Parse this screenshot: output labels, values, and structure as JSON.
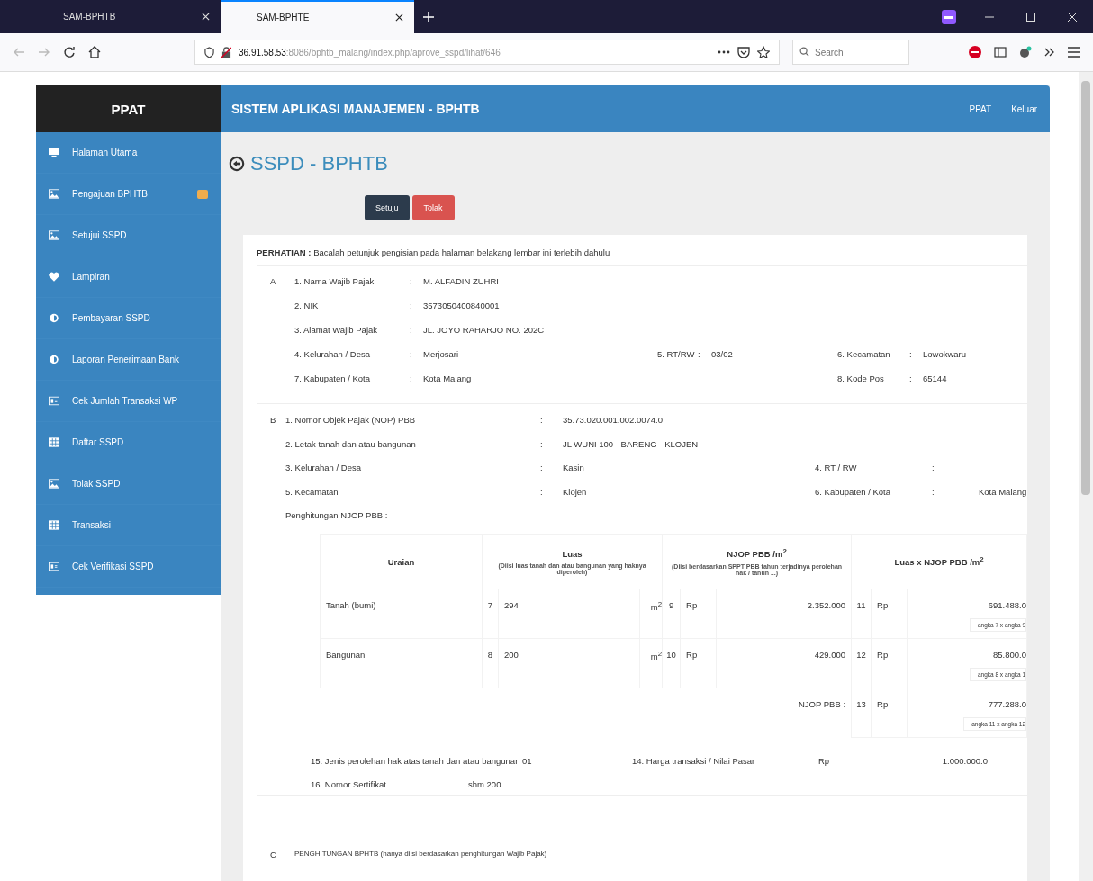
{
  "browser": {
    "tabs": [
      {
        "title": "SAM-BPHTB",
        "selected": false
      },
      {
        "title": "SAM-BPHTE",
        "selected": true
      }
    ],
    "url": {
      "host": "36.91.58.53",
      "path": ":8086/bphtb_malang/index.php/aprove_sspd/lihat/646"
    },
    "search": {
      "placeholder": "Search"
    }
  },
  "sidebar": {
    "title": "PPAT",
    "items": [
      {
        "label": "Halaman Utama",
        "badge": false
      },
      {
        "label": "Pengajuan BPHTB",
        "badge": true
      },
      {
        "label": "Setujui SSPD",
        "badge": false
      },
      {
        "label": "Lampiran",
        "badge": false
      },
      {
        "label": "Pembayaran SSPD",
        "badge": false
      },
      {
        "label": "Laporan Penerimaan Bank",
        "badge": false
      },
      {
        "label": "Cek Jumlah Transaksi WP",
        "badge": false
      },
      {
        "label": "Daftar SSPD",
        "badge": false
      },
      {
        "label": "Tolak SSPD",
        "badge": false
      },
      {
        "label": "Transaksi",
        "badge": false
      },
      {
        "label": "Cek Verifikasi SSPD",
        "badge": false
      }
    ]
  },
  "header": {
    "title": "SISTEM APLIKASI MANAJEMEN - BPHTB",
    "links": [
      "PPAT",
      "Keluar"
    ]
  },
  "page_title": "SSPD - BPHTB",
  "actions": [
    {
      "label": "Setuju",
      "kind": "approve"
    },
    {
      "label": "Tolak",
      "kind": "reject"
    }
  ],
  "notice": "**PERHATIAN :** Bacalah petunjuk pengisian pada halaman belakang lembar ini terlebih dahulu",
  "section_a": {
    "letter": "A",
    "separator": ":",
    "rows": [
      {
        "label": "1. Nama Wajib Pajak",
        "value": "M. ALFADIN ZUHRI"
      },
      {
        "label": "2. NIK",
        "value": "3573050400840001"
      },
      {
        "label": "3. Alamat Wajib Pajak",
        "value": "JL. JOYO RAHARJO NO. 202C"
      },
      {
        "label": "4. Kelurahan / Desa",
        "value": "Merjosari",
        "middle": {
          "label": "5. RT/RW",
          "value": "03/02"
        },
        "right": {
          "label": "6. Kecamatan",
          "value": "Lowokwaru"
        }
      },
      {
        "label": "7. Kabupaten / Kota",
        "value": "Kota Malang",
        "right": {
          "label": "8. Kode Pos",
          "value": "65144"
        }
      }
    ]
  },
  "section_b": {
    "letter": "B",
    "separator": ":",
    "rows": [
      {
        "label": "1. Nomor Objek Pajak (NOP) PBB",
        "value": "35.73.020.001.002.0074.0"
      },
      {
        "label": "2. Letak tanah dan atau bangunan",
        "value": "JL WUNI 100 - BARENG - KLOJEN"
      },
      {
        "label": "3. Kelurahan / Desa",
        "value": "Kasin",
        "right": {
          "label": "4. RT / RW"
        }
      },
      {
        "label": "5. Kecamatan",
        "value": "Klojen",
        "right": {
          "label": "6. Kabupaten / Kota",
          "value": "Kota Malang"
        }
      }
    ],
    "calc_label": "Penghitungan NJOP PBB :",
    "table": {
      "columns": [
        {
          "title": "Uraian"
        },
        {
          "title": "Luas",
          "note": "(Diisi luas tanah dan atau bangunan yang haknya diperoleh)"
        },
        {
          "title": "NJOP PBB /m$^{2}$",
          "note": "(Diisi berdasarkan SPPT PBB tahun terjadinya perolehan hak / tahun ...)"
        },
        {
          "title": "Luas x NJOP PBB /m$^{2}$"
        }
      ],
      "rows": [
        {
          "item": "Tanah (bumi)",
          "area_no": "7",
          "area": "294",
          "unit": "m$^{2}$",
          "njop_no": "9",
          "njop_currency": "Rp",
          "njop": "2.352.000",
          "total_no": "11",
          "total_currency": "Rp",
          "total": "691.488.0",
          "formula": "angka 7 x angka 9"
        },
        {
          "item": "Bangunan",
          "area_no": "8",
          "area": "200",
          "unit": "m$^{2}$",
          "njop_no": "10",
          "njop_currency": "Rp",
          "njop": "429.000",
          "total_no": "12",
          "total_currency": "Rp",
          "total": "85.800.0",
          "formula": "angka 8 x angka 1"
        }
      ],
      "sum": {
        "label": "NJOP PBB :",
        "no": "13",
        "currency": "Rp",
        "value": "777.288.0",
        "formula": "angka 11 x angka 12"
      }
    },
    "acquisition": {
      "label": "15. Jenis perolehan hak atas tanah dan atau bangunan 01",
      "price_label": "14. Harga transaksi / Nilai Pasar",
      "price_currency": "Rp",
      "price": "1.000.000.0"
    },
    "certificate": {
      "label": "16. Nomor Sertifikat",
      "value": "shm 200"
    }
  },
  "section_c": {
    "letter": "C",
    "title": "PENGHITUNGAN BPHTB (hanya diisi berdasarkan penghitungan Wajib Pajak)"
  }
}
